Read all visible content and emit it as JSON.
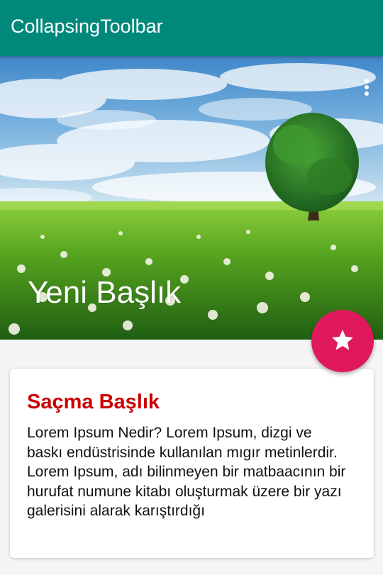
{
  "app_bar": {
    "title": "CollapsingToolbar",
    "background": "#00897b"
  },
  "hero": {
    "image": "landscape-tree-meadow",
    "title": "Yeni Başlık",
    "overflow_icon": "more-vert-icon"
  },
  "fab": {
    "icon": "star-icon",
    "color": "#e0195f"
  },
  "card": {
    "title": "Saçma Başlık",
    "title_color": "#cc0000",
    "body": "Lorem Ipsum Nedir? Lorem Ipsum, dizgi ve baskı endüstrisinde kullanılan mıgır metinlerdir. Lorem Ipsum, adı bilinmeyen bir matbaacının bir hurufat numune kitabı oluşturmak üzere bir yazı galerisini alarak karıştırdığı"
  }
}
